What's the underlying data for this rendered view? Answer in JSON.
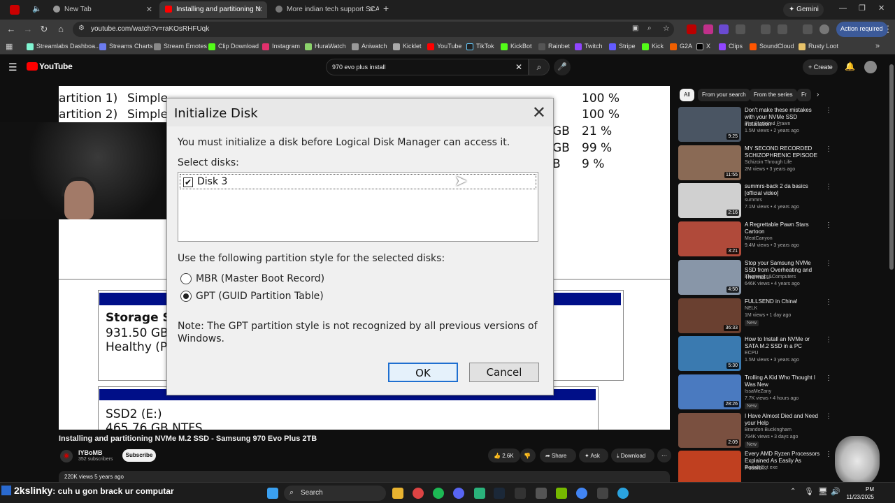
{
  "browser": {
    "tabs": [
      {
        "label": "New Tab"
      },
      {
        "label": "Installing and partitioning N"
      },
      {
        "label": "More indian tech support SCAM"
      }
    ],
    "gemini_label": "Gemini",
    "url": "youtube.com/watch?v=raKOsRHFUqk",
    "action_required": "Action required",
    "bookmarks": [
      "Streamlabs Dashboa...",
      "Streams Charts",
      "Stream Emotes",
      "Clip Download",
      "Instagram",
      "HuraWatch",
      "Aniwatch",
      "Kicklet",
      "YouTube",
      "TikTok",
      "KickBot",
      "Rainbet",
      "Twitch",
      "Stripe",
      "Kick",
      "G2A",
      "X",
      "Clips",
      "SoundCloud",
      "Rusty Loot"
    ]
  },
  "youtube": {
    "logo": "YouTube",
    "search_value": "970 evo plus install",
    "create_label": "Create"
  },
  "video_bg": {
    "rows": [
      {
        "part": "artition 1)",
        "type": "Simple",
        "pct": "100 %"
      },
      {
        "part": "artition 2)",
        "type": "Simple",
        "pct": "100 %"
      }
    ],
    "right_col": [
      {
        "gb": "GB",
        "pct": "21 %"
      },
      {
        "gb": "GB",
        "pct": "99 %"
      },
      {
        "gb": "B",
        "pct": "9 %"
      }
    ],
    "storage_title": "Storage SS",
    "storage_size": "931.50 GB N",
    "storage_state": "Healthy (Pri",
    "ssd2_title": "SSD2  (E:)",
    "ssd2_size": "465.76 GB NTFS"
  },
  "dialog": {
    "title": "Initialize Disk",
    "message": "You must initialize a disk before Logical Disk Manager can access it.",
    "select_label": "Select disks:",
    "disk_item": "Disk 3",
    "partition_label": "Use the following partition style for the selected disks:",
    "mbr_label": "MBR (Master Boot Record)",
    "gpt_label": "GPT (GUID Partition Table)",
    "note_line1": "Note: The GPT partition style is not recognized by all previous versions of",
    "note_line2": "Windows.",
    "ok_label": "OK",
    "cancel_label": "Cancel"
  },
  "video_info": {
    "title": "Installing and partitioning NVMe M.2 SSD - Samsung 970 Evo Plus 2TB",
    "channel": "IYBoMB",
    "subscribers": "352 subscribers",
    "subscribe_label": "Subscribe",
    "likes": "2.6K",
    "share_label": "Share",
    "ask_label": "Ask",
    "download_label": "Download",
    "views": "220K views  5 years ago"
  },
  "sidebar": {
    "chips": [
      "All",
      "From your search",
      "From the series",
      "Fr"
    ],
    "items": [
      {
        "title": "Don't make these mistakes with your NVMe SSD installation - ...",
        "channel": "The Provoked Prawn",
        "meta": "1.5M views • 2 years ago",
        "duration": "9:25",
        "thumb_color": "#4a5563",
        "new": ""
      },
      {
        "title": "MY SECOND RECORDED SCHIZOPHRENIC EPISODE",
        "channel": "Schizoin Through Life",
        "meta": "2M views • 3 years ago",
        "duration": "11:55",
        "thumb_color": "#8a6a55",
        "new": ""
      },
      {
        "title": "summrs-back 2 da basics [official video]",
        "channel": "summrs",
        "meta": "7.1M views • 4 years ago",
        "duration": "2:16",
        "thumb_color": "#d0d0d0",
        "new": ""
      },
      {
        "title": "A Regrettable Pawn Stars Cartoon",
        "channel": "MeatCanyon",
        "meta": "9.4M views • 3 years ago",
        "duration": "3:21",
        "thumb_color": "#b04a3a",
        "new": ""
      },
      {
        "title": "Stop your Samsung NVMe SSD from Overheating and Thermal...",
        "channel": "Electronics&Computers",
        "meta": "646K views • 4 years ago",
        "duration": "4:50",
        "thumb_color": "#8896a8",
        "new": ""
      },
      {
        "title": "FULLSEND in China!",
        "channel": "NELK",
        "meta": "1M views • 1 day ago",
        "duration": "36:33",
        "thumb_color": "#6a4030",
        "new": "New"
      },
      {
        "title": "How to Install an NVMe or SATA M.2 SSD in a PC",
        "channel": "ECPU",
        "meta": "1.5M views • 3 years ago",
        "duration": "5:30",
        "thumb_color": "#3a7ab0",
        "new": ""
      },
      {
        "title": "Trolling A Kid Who Thought I Was New",
        "channel": "IssaMeZany",
        "meta": "7.7K views • 4 hours ago",
        "duration": "28:26",
        "thumb_color": "#4a7ac0",
        "new": "New"
      },
      {
        "title": "I Have Almost Died and Need your Help",
        "channel": "Brandon Buckingham",
        "meta": "794K views • 3 days ago",
        "duration": "2:09",
        "thumb_color": "#7a5040",
        "new": "New"
      },
      {
        "title": "Every AMD Ryzen Processors Explained As Easily As Possibl...",
        "channel": "explain dot exe",
        "meta": "",
        "duration": "",
        "thumb_color": "#c04020",
        "new": ""
      }
    ]
  },
  "taskbar": {
    "chat_user": "2kslinky",
    "chat_msg": ": cuh u gon brack ur computar",
    "search_label": "Search",
    "clock_time": "PM",
    "clock_date": "11/23/2025"
  },
  "colors": {
    "accent_blue": "#1f6fd0",
    "disk_bar": "#000f88",
    "youtube_red": "#ff0000"
  }
}
